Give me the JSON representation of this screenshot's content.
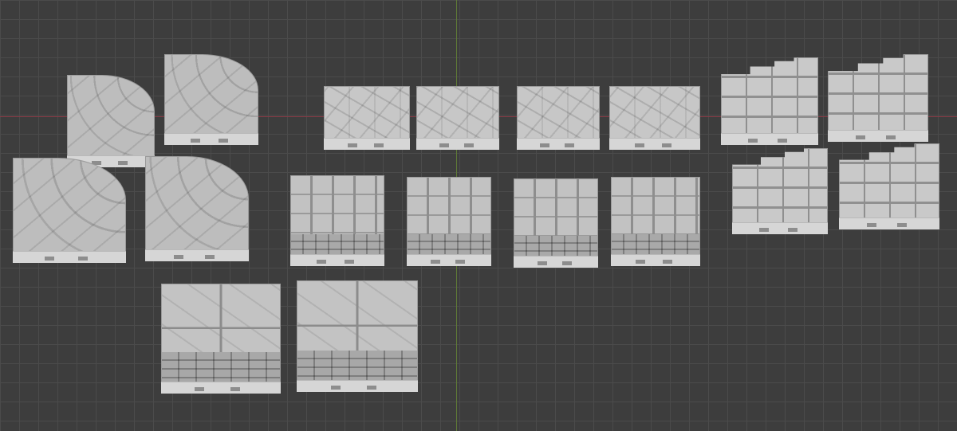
{
  "viewport": {
    "background_color": "#3d3d3d",
    "grid_color": "#4b4b4b",
    "x_axis_color": "#8a3b46",
    "y_axis_color": "#5f7a36"
  },
  "scene_objects": [
    {
      "kind": "curved-flagstone-corner-tile"
    },
    {
      "kind": "curved-flagstone-corner-tile"
    },
    {
      "kind": "curved-flagstone-corner-tile"
    },
    {
      "kind": "curved-flagstone-corner-tile"
    },
    {
      "kind": "flat-flagstone-floor-tile"
    },
    {
      "kind": "flat-flagstone-floor-tile"
    },
    {
      "kind": "flat-flagstone-floor-tile"
    },
    {
      "kind": "flat-flagstone-floor-tile"
    },
    {
      "kind": "straight-stair-tile"
    },
    {
      "kind": "straight-stair-tile"
    },
    {
      "kind": "straight-stair-tile"
    },
    {
      "kind": "straight-stair-tile"
    },
    {
      "kind": "corner-step-tile"
    },
    {
      "kind": "corner-step-tile"
    },
    {
      "kind": "corner-step-tile"
    },
    {
      "kind": "corner-step-tile"
    },
    {
      "kind": "large-block-tile"
    },
    {
      "kind": "large-block-tile"
    }
  ]
}
